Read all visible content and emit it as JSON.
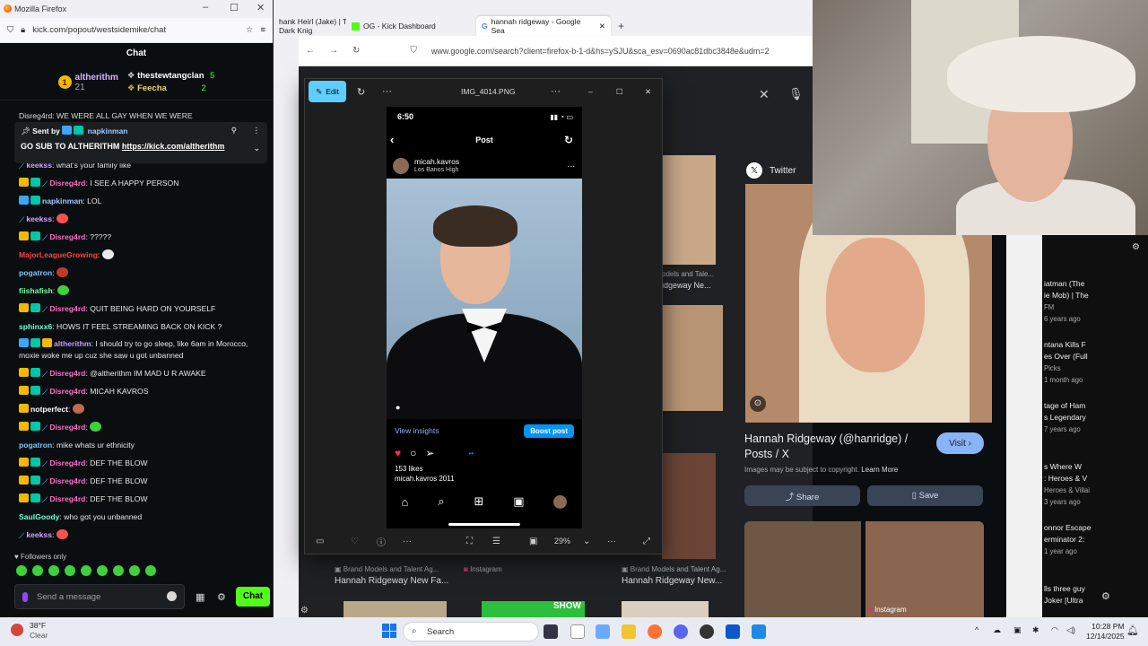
{
  "chat_window": {
    "title": "Mozilla Firefox",
    "url": "kick.com/popout/westsidemike/chat",
    "header": "Chat",
    "leaderboard": {
      "left_user": "altherithm",
      "left_rank": "1",
      "left_count": "21",
      "top_user": "thestewtangclan",
      "top_count": "5",
      "second_user": "Feecha",
      "second_count": "2"
    },
    "partial_message": "Disreg4rd: WE WERE ALL GAY WHEN WE WERE",
    "pinned": {
      "sent_by_label": "Sent by",
      "sent_by_user": "napkinman",
      "text": "GO SUB TO ALTHERITHM ",
      "link": "https://kick.com/altherithm"
    },
    "messages": [
      {
        "user": "keekss",
        "color": "#d7a5ff",
        "text": ": what's your family like",
        "badges": [
          "sword"
        ]
      },
      {
        "user": "Disreg4rd",
        "color": "#ff6ec7",
        "text": ": I SEE A HAPPY PERSON",
        "badges": [
          "crown",
          "gift",
          "sword"
        ]
      },
      {
        "user": "napkinman",
        "color": "#9ec9ff",
        "text": ": LOL",
        "badges": [
          "sub",
          "gift"
        ]
      },
      {
        "user": "keekss",
        "color": "#d7a5ff",
        "text": ": ",
        "badges": [
          "sword"
        ],
        "emote": "#ff5050"
      },
      {
        "user": "Disreg4rd",
        "color": "#ff6ec7",
        "text": ": ?????",
        "badges": [
          "crown",
          "gift",
          "sword"
        ]
      },
      {
        "user": "MajorLeagueGrowing",
        "color": "#ff4242",
        "text": ": ",
        "badges": [],
        "emote": "#e8e8e8"
      },
      {
        "user": "pogatron",
        "color": "#7ec8ff",
        "text": ": ",
        "badges": [],
        "emote": "#c23b22"
      },
      {
        "user": "fiishafish",
        "color": "#72ff9c",
        "text": ": ",
        "badges": [],
        "emote": "#3dd13a"
      },
      {
        "user": "Disreg4rd",
        "color": "#ff6ec7",
        "text": ": QUIT BEING HARD ON YOURSELF",
        "badges": [
          "crown",
          "gift",
          "sword"
        ]
      },
      {
        "user": "sphinxx6",
        "color": "#72ffd6",
        "text": ": HOWS IT FEEL STREAMING BACK ON KICK ?",
        "badges": []
      },
      {
        "user": "altherithm",
        "color": "#c49bff",
        "text": ": I should try to go sleep, like 6am in Morocco, moxie woke me up cuz she saw u got unbanned",
        "badges": [
          "sub",
          "gift",
          "crown"
        ],
        "wrap": true
      },
      {
        "user": "Disreg4rd",
        "color": "#ff6ec7",
        "text": ": @altherithm IM MAD U R AWAKE",
        "badges": [
          "crown",
          "gift",
          "sword"
        ]
      },
      {
        "user": "Disreg4rd",
        "color": "#ff6ec7",
        "text": ": MICAH KAVROS",
        "badges": [
          "crown",
          "gift",
          "sword"
        ]
      },
      {
        "user": "notperfect",
        "color": "#ffffff",
        "text": ": ",
        "badges": [
          "crown"
        ],
        "emote": "#c06b4f"
      },
      {
        "user": "Disreg4rd",
        "color": "#ff6ec7",
        "text": ": ",
        "badges": [
          "crown",
          "gift",
          "sword"
        ],
        "emote": "#3dd13a"
      },
      {
        "user": "pogatron",
        "color": "#7ec8ff",
        "text": ": mike whats ur ethnicity",
        "badges": []
      },
      {
        "user": "Disreg4rd",
        "color": "#ff6ec7",
        "text": ": DEF THE BLOW",
        "badges": [
          "crown",
          "gift",
          "sword"
        ]
      },
      {
        "user": "Disreg4rd",
        "color": "#ff6ec7",
        "text": ": DEF THE BLOW",
        "badges": [
          "crown",
          "gift",
          "sword"
        ]
      },
      {
        "user": "Disreg4rd",
        "color": "#ff6ec7",
        "text": ": DEF THE BLOW",
        "badges": [
          "crown",
          "gift",
          "sword"
        ]
      },
      {
        "user": "SaulGoody",
        "color": "#72ffd6",
        "text": ": who got you unbanned",
        "badges": []
      },
      {
        "user": "keekss",
        "color": "#d7a5ff",
        "text": ": ",
        "badges": [
          "sword"
        ],
        "emote": "#ff5050"
      }
    ],
    "followers_only": "Followers only",
    "composer_placeholder": "Send a message",
    "chat_button": "Chat"
  },
  "browser": {
    "tabs": [
      "hank Heirl (Jake) | The Dark Knig",
      "OG - Kick Dashboard",
      "hannah ridgeway - Google Sea"
    ],
    "url": "www.google.com/search?client=firefox-b-1-d&hs=ySJU&sca_esv=0690ac81dbc3848e&udm=2"
  },
  "google": {
    "source": "Twitter",
    "title": "Hannah Ridgeway (@hanridge) / Posts / X",
    "visit": "Visit",
    "copyright": "Images may be subject to copyright.",
    "learn_more": "Learn More",
    "share": "Share",
    "save": "Save",
    "thumb_source_1": "Brand Models and Talent Ag...",
    "thumb_source_2": "Instagram",
    "thumb_source_3": "Brand Models and Talent Ag...",
    "thumb_title_1": "Hannah Ridgeway New Fa...",
    "thumb_title_2": "Hannah Ridgeway New...",
    "side_source": "odels and Tale...",
    "side_title": "idgeway Ne...",
    "more_label": "re",
    "bottom_source": "Instagram",
    "show_text": "SHOW"
  },
  "photos": {
    "edit": "Edit",
    "filename": "IMG_4014.PNG",
    "zoom": "29%",
    "phone": {
      "time": "6:50",
      "header": "Post",
      "user": "micah.kavros",
      "location": "Los Banos High",
      "insights": "View insights",
      "boost": "Boost post",
      "likes": "153 likes",
      "caption": "micah.kavros 2011"
    }
  },
  "yt": [
    {
      "title": "iatman (The",
      "line2": "ie Mob) | The",
      "meta": "FM",
      "age": "6 years ago"
    },
    {
      "title": "ntana Kills F",
      "line2": "es Over (Full",
      "meta": "Picks",
      "age": "1 month ago"
    },
    {
      "title": "tage of Ham",
      "line2": "s Legendary",
      "meta": "",
      "age": "7 years ago"
    },
    {
      "title": "s Where W",
      "line2": ": Heroes & V",
      "meta": "Heroes & Villai",
      "age": "3 years ago"
    },
    {
      "title": "onnor Escape",
      "line2": "erminator 2:",
      "meta": "",
      "age": "1 year ago"
    },
    {
      "title": "lls three guy",
      "line2": "Joker [Ultra",
      "meta": "",
      "age": ""
    }
  ],
  "taskbar": {
    "weather_temp": "38°F",
    "weather_desc": "Clear",
    "search": "Search",
    "time": "10:28 PM",
    "date": "12/14/2025"
  }
}
